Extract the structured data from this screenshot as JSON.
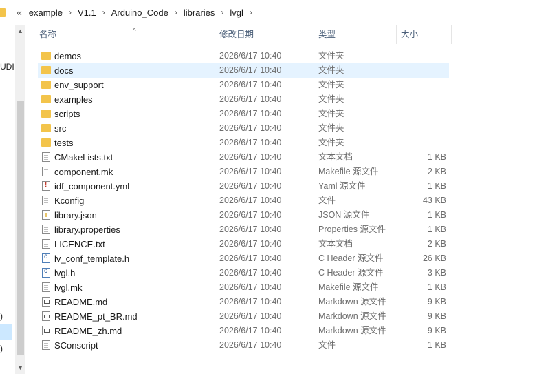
{
  "address_bar": {
    "overflow": "«",
    "crumbs": [
      "example",
      "V1.1",
      "Arduino_Code",
      "libraries",
      "lvgl"
    ]
  },
  "left_pane": {
    "fragment_top": "UDI",
    "fragment_a": ")",
    "fragment_b": ")"
  },
  "columns": {
    "name": "名称",
    "date": "修改日期",
    "type": "类型",
    "size": "大小"
  },
  "files": [
    {
      "name": "demos",
      "date": "2026/6/17 10:40",
      "type": "文件夹",
      "size": "",
      "icon": "folder-icon"
    },
    {
      "name": "docs",
      "date": "2026/6/17 10:40",
      "type": "文件夹",
      "size": "",
      "icon": "folder-icon",
      "selected": true
    },
    {
      "name": "env_support",
      "date": "2026/6/17 10:40",
      "type": "文件夹",
      "size": "",
      "icon": "folder-icon"
    },
    {
      "name": "examples",
      "date": "2026/6/17 10:40",
      "type": "文件夹",
      "size": "",
      "icon": "folder-icon"
    },
    {
      "name": "scripts",
      "date": "2026/6/17 10:40",
      "type": "文件夹",
      "size": "",
      "icon": "folder-icon"
    },
    {
      "name": "src",
      "date": "2026/6/17 10:40",
      "type": "文件夹",
      "size": "",
      "icon": "folder-icon"
    },
    {
      "name": "tests",
      "date": "2026/6/17 10:40",
      "type": "文件夹",
      "size": "",
      "icon": "folder-icon"
    },
    {
      "name": "CMakeLists.txt",
      "date": "2026/6/17 10:40",
      "type": "文本文档",
      "size": "1 KB",
      "icon": "text-file-icon"
    },
    {
      "name": "component.mk",
      "date": "2026/6/17 10:40",
      "type": "Makefile 源文件",
      "size": "2 KB",
      "icon": "file-icon"
    },
    {
      "name": "idf_component.yml",
      "date": "2026/6/17 10:40",
      "type": "Yaml 源文件",
      "size": "1 KB",
      "icon": "yaml-file-icon"
    },
    {
      "name": "Kconfig",
      "date": "2026/6/17 10:40",
      "type": "文件",
      "size": "43 KB",
      "icon": "file-icon"
    },
    {
      "name": "library.json",
      "date": "2026/6/17 10:40",
      "type": "JSON 源文件",
      "size": "1 KB",
      "icon": "json-file-icon"
    },
    {
      "name": "library.properties",
      "date": "2026/6/17 10:40",
      "type": "Properties 源文件",
      "size": "1 KB",
      "icon": "file-icon"
    },
    {
      "name": "LICENCE.txt",
      "date": "2026/6/17 10:40",
      "type": "文本文档",
      "size": "2 KB",
      "icon": "text-file-icon"
    },
    {
      "name": "lv_conf_template.h",
      "date": "2026/6/17 10:40",
      "type": "C Header 源文件",
      "size": "26 KB",
      "icon": "c-header-file-icon"
    },
    {
      "name": "lvgl.h",
      "date": "2026/6/17 10:40",
      "type": "C Header 源文件",
      "size": "3 KB",
      "icon": "c-header-file-icon"
    },
    {
      "name": "lvgl.mk",
      "date": "2026/6/17 10:40",
      "type": "Makefile 源文件",
      "size": "1 KB",
      "icon": "file-icon"
    },
    {
      "name": "README.md",
      "date": "2026/6/17 10:40",
      "type": "Markdown 源文件",
      "size": "9 KB",
      "icon": "markdown-file-icon"
    },
    {
      "name": "README_pt_BR.md",
      "date": "2026/6/17 10:40",
      "type": "Markdown 源文件",
      "size": "9 KB",
      "icon": "markdown-file-icon"
    },
    {
      "name": "README_zh.md",
      "date": "2026/6/17 10:40",
      "type": "Markdown 源文件",
      "size": "9 KB",
      "icon": "markdown-file-icon"
    },
    {
      "name": "SConscript",
      "date": "2026/6/17 10:40",
      "type": "文件",
      "size": "1 KB",
      "icon": "file-icon"
    }
  ],
  "colors": {
    "folder": "#f3c44b",
    "selected_row": "#e5f3ff",
    "header_text": "#4c607a"
  }
}
